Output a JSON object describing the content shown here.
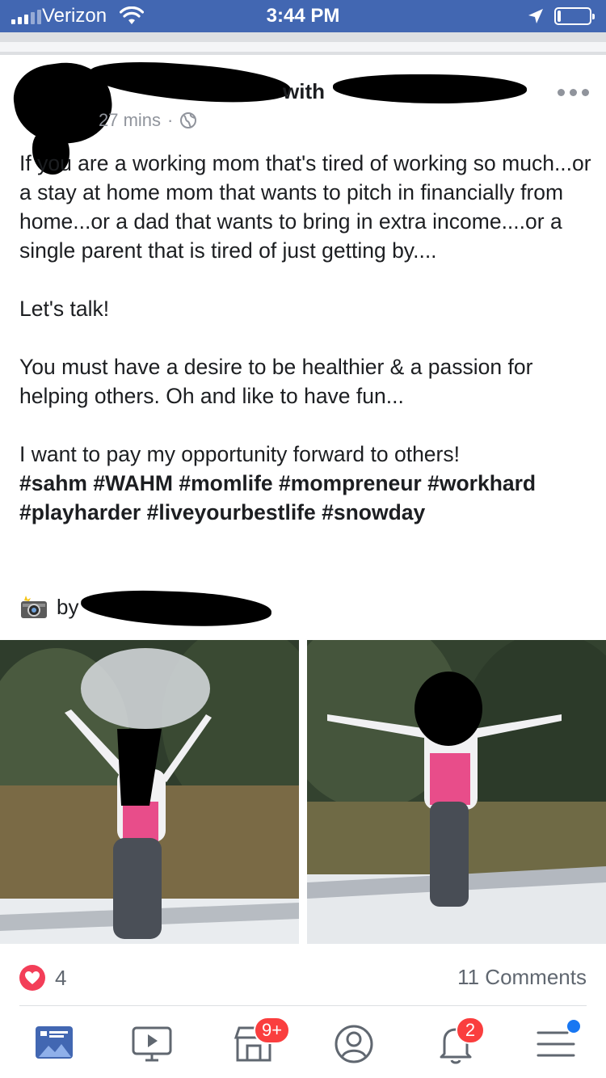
{
  "status_bar": {
    "carrier": "Verizon",
    "time": "3:44 PM",
    "battery_level": 0.2
  },
  "post": {
    "header": {
      "author_suffix": "with",
      "time_ago": "27 mins",
      "separator": "·",
      "audience_icon": "globe-icon"
    },
    "paragraphs": [
      "If you are a working mom that's tired of working so much...or a stay at home mom that wants to pitch in financially from home...or a dad that wants to bring in extra income....or a single parent that is tired of just getting by....",
      "Let's talk!",
      "You must have a desire to be healthier & a passion for helping others. Oh and like to have fun...",
      "I want to pay my opportunity forward to others!"
    ],
    "hashtags": "#sahm #WAHM #momlife #mompreneur #workhard #playharder #liveyourbestlife #snowday",
    "credit": {
      "icon": "camera-flash-icon",
      "prefix": "by"
    },
    "reactions": {
      "icon": "heart-icon",
      "count": "4"
    },
    "comments": "11 Comments"
  },
  "bottom_nav": {
    "items": [
      {
        "name": "news-feed",
        "icon": "news-feed-icon",
        "active": true
      },
      {
        "name": "watch",
        "icon": "video-icon"
      },
      {
        "name": "marketplace",
        "icon": "shop-icon",
        "badge": "9+"
      },
      {
        "name": "profile",
        "icon": "profile-icon"
      },
      {
        "name": "notifications",
        "icon": "bell-icon",
        "badge": "2"
      },
      {
        "name": "menu",
        "icon": "menu-icon"
      }
    ]
  },
  "colors": {
    "brand": "#4267b2",
    "badge": "#fa3e3e",
    "reaction": "#f33e58",
    "muted_text": "#606770"
  }
}
